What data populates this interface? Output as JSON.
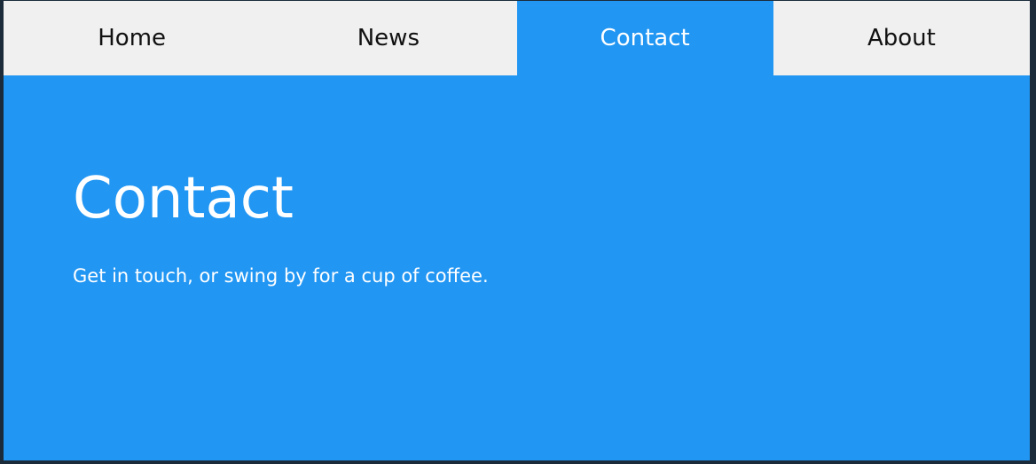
{
  "nav": {
    "tabs": [
      {
        "label": "Home",
        "active": false
      },
      {
        "label": "News",
        "active": false
      },
      {
        "label": "Contact",
        "active": true
      },
      {
        "label": "About",
        "active": false
      }
    ]
  },
  "main": {
    "title": "Contact",
    "text": "Get in touch, or swing by for a cup of coffee."
  },
  "colors": {
    "accent": "#2196f3",
    "tab_inactive_bg": "#f0f0f0",
    "tab_inactive_text": "#111111",
    "active_text": "#ffffff",
    "outer_bg": "#1c2b3a"
  }
}
